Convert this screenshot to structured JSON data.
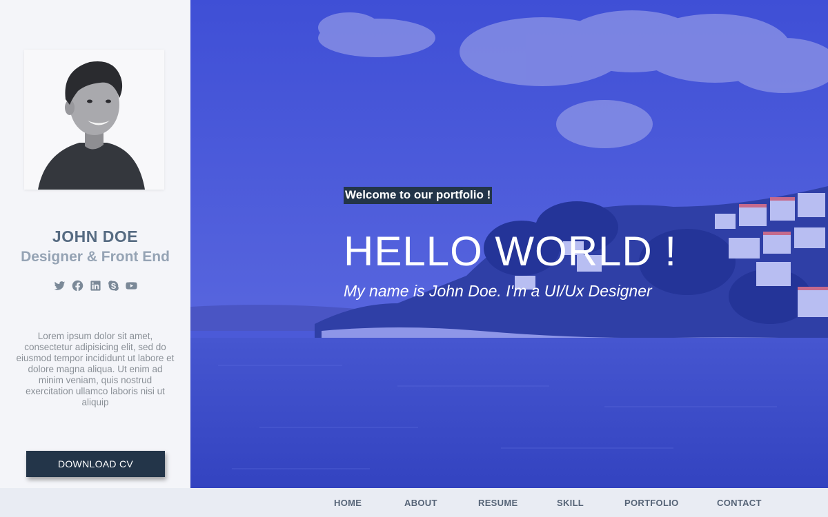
{
  "profile": {
    "name": "JOHN DOE",
    "role": "Designer & Front End",
    "bio": "Lorem ipsum dolor sit amet, consectetur adipisicing elit, sed do eiusmod tempor incididunt ut labore et dolore magna aliqua. Ut enim ad minim veniam, quis nostrud exercitation ullamco laboris nisi ut aliquip",
    "download_label": "DOWNLOAD CV",
    "socials": [
      "twitter-icon",
      "facebook-icon",
      "linkedin-icon",
      "skype-icon",
      "youtube-icon"
    ]
  },
  "hero": {
    "welcome": "Welcome to our portfolio !",
    "headline": "HELLO WORLD !",
    "tagline": "My name is John Doe. I'm a UI/Ux Designer"
  },
  "nav": {
    "items": [
      "HOME",
      "ABOUT",
      "RESUME",
      "SKILL",
      "PORTFOLIO",
      "CONTACT"
    ]
  },
  "colors": {
    "accent_dark": "#233549",
    "hero_overlay": "#4b5ad8",
    "name_text": "#566b82",
    "role_text": "#95a3b4"
  }
}
